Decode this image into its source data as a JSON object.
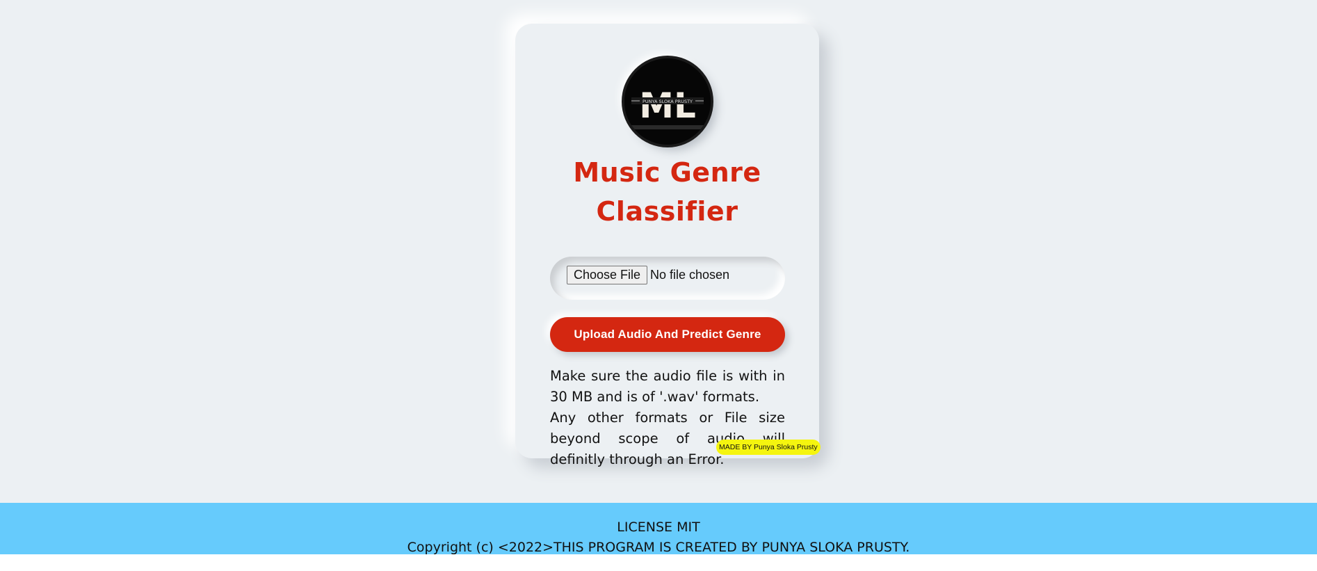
{
  "logo": {
    "icon": "ml-logo-icon",
    "letters": "ML",
    "tagline": "PUNYA SLOKA PRUSTY"
  },
  "title": {
    "line1": "Music Genre",
    "line2": "Classifier"
  },
  "file_input": {
    "button_label": "Choose File",
    "status": "No file chosen"
  },
  "upload_button": {
    "label": "Upload Audio And Predict Genre"
  },
  "note": {
    "line1": "Make sure the audio file is with in 30 MB and is of '.wav' formats.",
    "line2": "Any other formats or File size beyond scope of audio will definitly through an Error."
  },
  "badge": {
    "text": "MADE BY Punya Sloka Prusty"
  },
  "footer": {
    "license": "LICENSE MIT",
    "copyright": "Copyright (c) <2022>THIS PROGRAM IS CREATED BY PUNYA SLOKA PRUSTY."
  },
  "colors": {
    "background": "#ecf0f3",
    "accent": "#d42711",
    "footer": "#66cbfc",
    "badge": "#f5f50f"
  }
}
